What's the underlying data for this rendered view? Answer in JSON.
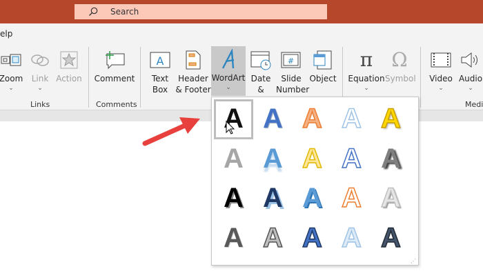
{
  "search": {
    "placeholder": "Search",
    "icon": "search-icon"
  },
  "tabs": {
    "partial_label": "elp"
  },
  "ribbon": {
    "buttons": [
      {
        "label": "Zoom",
        "chevron": "⌄"
      },
      {
        "label": "Link",
        "chevron": "⌄"
      },
      {
        "label": "Action"
      },
      {
        "label": "Comment"
      },
      {
        "label": "Text Box"
      },
      {
        "label": "Header & Footer"
      },
      {
        "label": "WordArt",
        "chevron": "⌄"
      },
      {
        "label": "Date & Time"
      },
      {
        "label": "Slide Number"
      },
      {
        "label": "Object"
      },
      {
        "label": "Equation",
        "chevron": "⌄"
      },
      {
        "label": "Symbol"
      },
      {
        "label": "Video",
        "chevron": "⌄"
      },
      {
        "label": "Audio",
        "chevron": "⌄"
      }
    ],
    "groups": {
      "links": "Links",
      "comments": "Comments",
      "media": "Medi"
    }
  },
  "wordart_gallery": {
    "glyph": "A",
    "styles": [
      {
        "fill": "#111111",
        "stroke": "none",
        "shadow": "none"
      },
      {
        "fill": "#4472c4",
        "stroke": "none",
        "shadow": "1px 1px 1px #9ab"
      },
      {
        "fill": "#f4b183",
        "stroke": "#ed7d31",
        "shadow": "none"
      },
      {
        "fill": "#ffffff",
        "stroke": "#9dc3e6",
        "shadow": "none"
      },
      {
        "fill": "#ffd700",
        "stroke": "#c9a000",
        "shadow": "2px 2px 2px #bbb"
      },
      {
        "fill": "#a6a6a6",
        "stroke": "none",
        "shadow": "none"
      },
      {
        "fill": "#5b9bd5",
        "stroke": "none",
        "shadow": "0 6px 2px #c5dcf0"
      },
      {
        "fill": "#ffe699",
        "stroke": "#e0b800",
        "shadow": "none"
      },
      {
        "fill": "#ffffff",
        "stroke": "#4472c4",
        "shadow": "none"
      },
      {
        "fill": "#7f7f7f",
        "stroke": "none",
        "shadow": "3px 2px 2px #444"
      },
      {
        "fill": "#000000",
        "stroke": "none",
        "shadow": "2px 2px 0 #888"
      },
      {
        "fill": "#1f3864",
        "stroke": "none",
        "shadow": "3px 3px 0 #9dc3e6"
      },
      {
        "fill": "#5b9bd5",
        "stroke": "none",
        "shadow": "2px 2px 0 #2e75b6"
      },
      {
        "fill": "#ffffff",
        "stroke": "#ed7d31",
        "shadow": "none"
      },
      {
        "fill": "#e7e6e6",
        "stroke": "#bfbfbf",
        "shadow": "2px 2px 1px #999"
      },
      {
        "fill": "#595959",
        "stroke": "none",
        "shadow": "1px 1px 0 #ccc"
      },
      {
        "fill": "#bfbfbf",
        "stroke": "#555555",
        "shadow": "none"
      },
      {
        "fill": "#4472c4",
        "stroke": "#1f3864",
        "shadow": "none"
      },
      {
        "fill": "#deebf7",
        "stroke": "#9dc3e6",
        "shadow": "none"
      },
      {
        "fill": "#44546a",
        "stroke": "#222a35",
        "shadow": "none"
      }
    ]
  },
  "colors": {
    "titlebar": "#b7472a",
    "search_bg": "#fcc9b9",
    "arrow": "#e8403c"
  }
}
